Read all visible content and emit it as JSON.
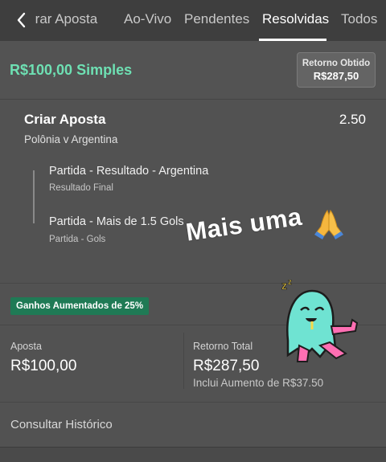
{
  "nav": {
    "tabs": [
      {
        "label": "rrar Aposta"
      },
      {
        "label": "Ao-Vivo"
      },
      {
        "label": "Pendentes"
      },
      {
        "label": "Resolvidas"
      },
      {
        "label": "Todos"
      }
    ],
    "active_tab": "Resolvidas",
    "back_icon": "chevron-left-icon"
  },
  "bet": {
    "stake_title": "R$100,00 Simples",
    "return_label": "Retorno Obtido",
    "return_value": "R$287,50",
    "selection_title": "Criar Aposta",
    "odds": "2.50",
    "event": "Polônia v Argentina",
    "legs": [
      {
        "market": "Partida - Resultado - Argentina",
        "sub": "Resultado Final"
      },
      {
        "market": "Partida - Mais de 1.5 Gols",
        "sub": "Partida - Gols"
      }
    ],
    "boost_badge": "Ganhos Aumentados de 25%",
    "stake_label": "Aposta",
    "stake_value": "R$100,00",
    "total_return_label": "Retorno Total",
    "total_return_value": "R$287,50",
    "boost_note": "Inclui Aumento de R$37.50",
    "history_link": "Consultar Histórico"
  },
  "overlay": {
    "caption": "Mais uma",
    "emoji_icon": "praying-hands-icon",
    "sticker": "zombie-ghost-sticker"
  },
  "colors": {
    "accent_green": "#6ee0b3",
    "badge_green": "#1f7a55",
    "background": "#525252",
    "topbar": "#3e3e3e"
  }
}
